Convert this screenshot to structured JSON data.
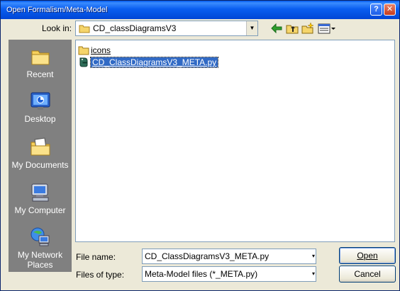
{
  "window": {
    "title": "Open Formalism/Meta-Model"
  },
  "look_in": {
    "label": "Look in:",
    "value": "CD_classDiagramsV3"
  },
  "toolbar": {
    "back_icon": "back-arrow-icon",
    "up_icon": "up-folder-icon",
    "new_folder_icon": "new-folder-icon",
    "view_menu_icon": "view-menu-icon"
  },
  "places": [
    {
      "label": "Recent",
      "icon": "recent-folder-icon"
    },
    {
      "label": "Desktop",
      "icon": "desktop-icon"
    },
    {
      "label": "My Documents",
      "icon": "my-documents-icon"
    },
    {
      "label": "My Computer",
      "icon": "my-computer-icon"
    },
    {
      "label": "My Network Places",
      "label_line1": "My Network",
      "label_line2": "Places",
      "icon": "network-places-icon"
    }
  ],
  "files": [
    {
      "name": "icons",
      "type": "folder"
    },
    {
      "name": "CD_ClassDiagramsV3_META.py",
      "type": "python-file",
      "selected": true
    }
  ],
  "file_name": {
    "label": "File name:",
    "value": "CD_ClassDiagramsV3_META.py"
  },
  "file_type": {
    "label": "Files of type:",
    "value": "Meta-Model files (*_META.py)"
  },
  "buttons": {
    "open": "Open",
    "cancel": "Cancel"
  },
  "colors": {
    "titlebar": "#0054e3",
    "selection": "#316ac5",
    "places_bg": "#808080",
    "dialog_bg": "#ece9d8"
  }
}
